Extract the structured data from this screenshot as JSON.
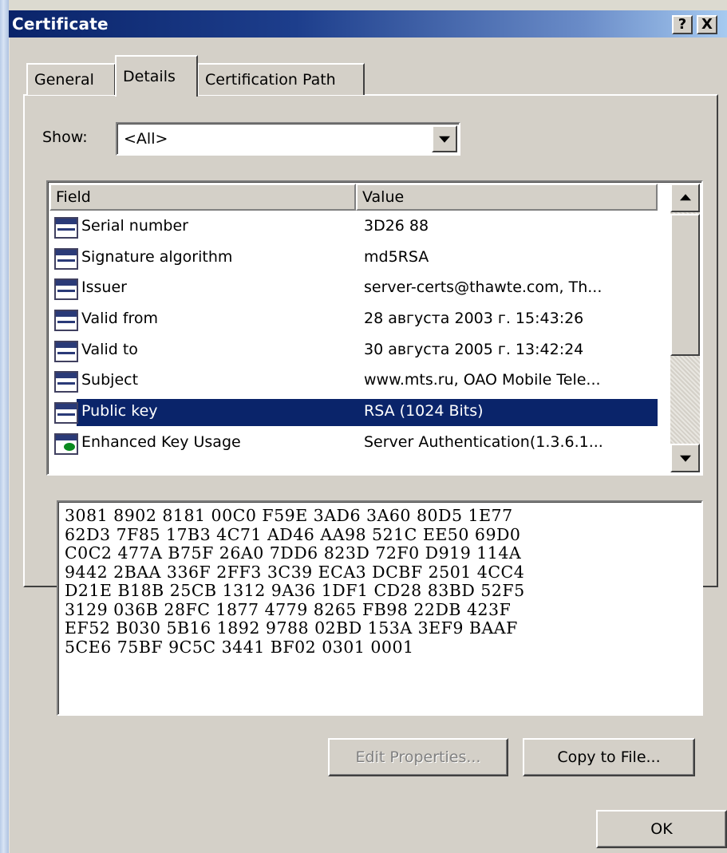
{
  "window": {
    "title": "Certificate",
    "help_label": "?",
    "close_label": "X"
  },
  "tabs": [
    {
      "label": "General",
      "active": false
    },
    {
      "label": "Details",
      "active": true
    },
    {
      "label": "Certification Path",
      "active": false
    }
  ],
  "show": {
    "label": "Show:",
    "value": "<All>"
  },
  "list": {
    "columns": [
      "Field",
      "Value"
    ],
    "rows": [
      {
        "field": "Serial number",
        "value": "3D26 88",
        "icon": "certificate-field-icon"
      },
      {
        "field": "Signature algorithm",
        "value": "md5RSA",
        "icon": "certificate-field-icon"
      },
      {
        "field": "Issuer",
        "value": "server-certs@thawte.com, Th...",
        "icon": "certificate-field-icon"
      },
      {
        "field": "Valid from",
        "value": "28 августа 2003 г. 15:43:26",
        "icon": "certificate-field-icon"
      },
      {
        "field": "Valid to",
        "value": "30 августа 2005 г. 13:42:24",
        "icon": "certificate-field-icon"
      },
      {
        "field": "Subject",
        "value": "www.mts.ru, OAO Mobile Tele...",
        "icon": "certificate-field-icon"
      },
      {
        "field": "Public key",
        "value": "RSA (1024 Bits)",
        "icon": "certificate-field-icon",
        "selected": true
      },
      {
        "field": "Enhanced Key Usage",
        "value": "Server Authentication(1.3.6.1...",
        "icon": "extension-field-icon"
      }
    ]
  },
  "hex_lines": [
    "3081 8902 8181 00C0 F59E 3AD6 3A60 80D5 1E77",
    "62D3 7F85 17B3 4C71 AD46 AA98 521C EE50 69D0",
    "C0C2 477A B75F 26A0 7DD6 823D 72F0 D919 114A",
    "9442 2BAA 336F 2FF3 3C39 ECA3 DCBF 2501 4CC4",
    "D21E B18B 25CB 1312 9A36 1DF1 CD28 83BD 52F5",
    "3129 036B 28FC 1877 4779 8265 FB98 22DB 423F",
    "EF52 B030 5B16 1892 9788 02BD 153A 3EF9 BAAF",
    "5CE6 75BF 9C5C 3441 BF02 0301 0001"
  ],
  "buttons": {
    "edit_properties": "Edit Properties...",
    "copy_to_file": "Copy to File...",
    "ok": "OK"
  }
}
